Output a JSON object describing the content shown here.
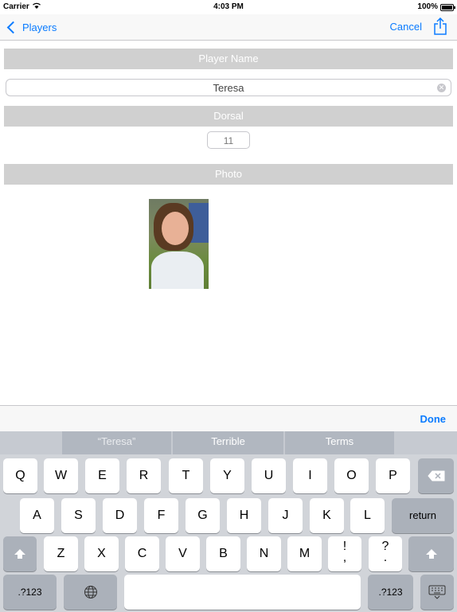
{
  "status_bar": {
    "carrier": "Carrier",
    "time": "4:03 PM",
    "battery": "100%"
  },
  "nav": {
    "back_label": "Players",
    "cancel_label": "Cancel",
    "share_icon": "share-icon"
  },
  "form": {
    "player_name_header": "Player Name",
    "player_name_value": "Teresa",
    "dorsal_header": "Dorsal",
    "dorsal_value": "11",
    "photo_header": "Photo"
  },
  "accessory": {
    "done_label": "Done"
  },
  "keyboard": {
    "suggestions": [
      "“Teresa”",
      "Terrible",
      "Terms"
    ],
    "row1": [
      "Q",
      "W",
      "E",
      "R",
      "T",
      "Y",
      "U",
      "I",
      "O",
      "P"
    ],
    "row2": [
      "A",
      "S",
      "D",
      "F",
      "G",
      "H",
      "J",
      "K",
      "L"
    ],
    "row3": [
      "Z",
      "X",
      "C",
      "V",
      "B",
      "N",
      "M",
      "!\n,",
      "?\n."
    ],
    "return_label": "return",
    "numbers_label": ".?123",
    "numbers_label_right": ".?123",
    "accent_color": "#0a7bff"
  }
}
